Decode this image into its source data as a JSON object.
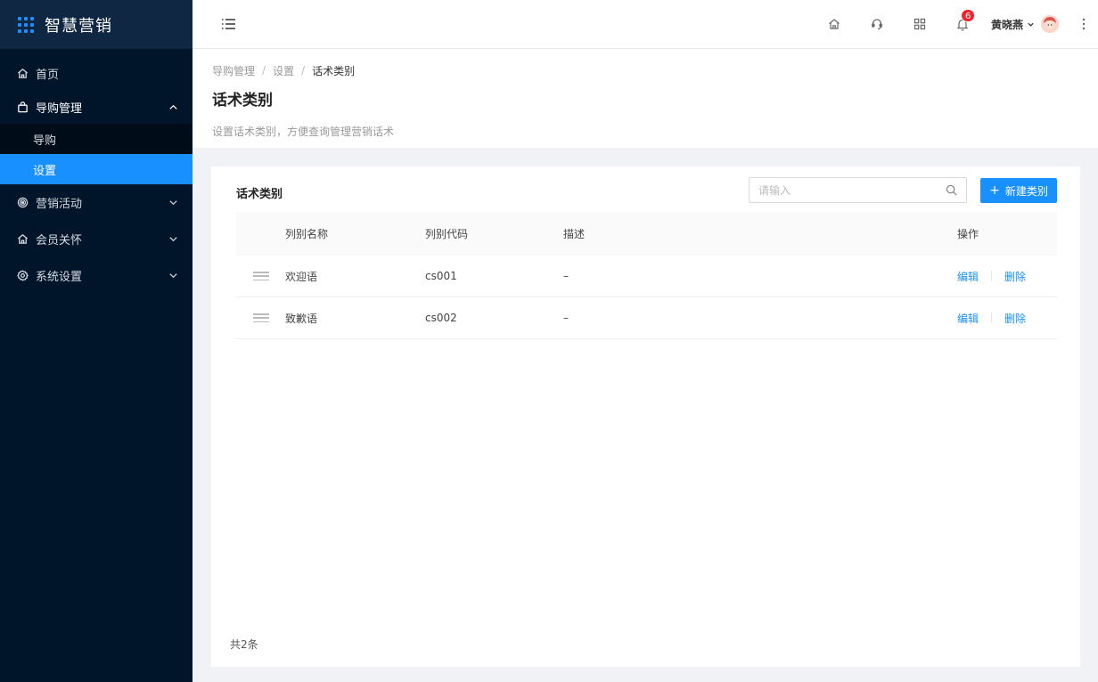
{
  "app": {
    "name": "智慧营销"
  },
  "sidebar": {
    "items": [
      {
        "label": "首页",
        "icon": "home-icon"
      },
      {
        "label": "导购管理",
        "icon": "shopping-bag-icon",
        "expanded": true,
        "children": [
          {
            "label": "导购"
          },
          {
            "label": "设置",
            "active": true
          }
        ]
      },
      {
        "label": "营销活动",
        "icon": "target-icon"
      },
      {
        "label": "会员关怀",
        "icon": "home-heart-icon"
      },
      {
        "label": "系统设置",
        "icon": "gear-icon"
      }
    ]
  },
  "header": {
    "notifications_count": "6",
    "user_name": "黄晓燕"
  },
  "breadcrumb": [
    "导购管理",
    "设置",
    "话术类别"
  ],
  "page": {
    "title": "话术类别",
    "description": "设置话术类别，方便查询管理营销话术"
  },
  "card": {
    "title": "话术类别",
    "search_placeholder": "请输入",
    "new_button": "新建类别"
  },
  "table": {
    "columns": [
      "列别名称",
      "列别代码",
      "描述",
      "操作"
    ],
    "rows": [
      {
        "name": "欢迎语",
        "code": "cs001",
        "desc": "–",
        "edit": "编辑",
        "delete": "删除"
      },
      {
        "name": "致歉语",
        "code": "cs002",
        "desc": "–",
        "edit": "编辑",
        "delete": "删除"
      }
    ]
  },
  "footer": {
    "total": "共2条"
  },
  "colors": {
    "primary": "#1890ff",
    "sidebar_bg": "#001529",
    "badge": "#f5222d"
  }
}
